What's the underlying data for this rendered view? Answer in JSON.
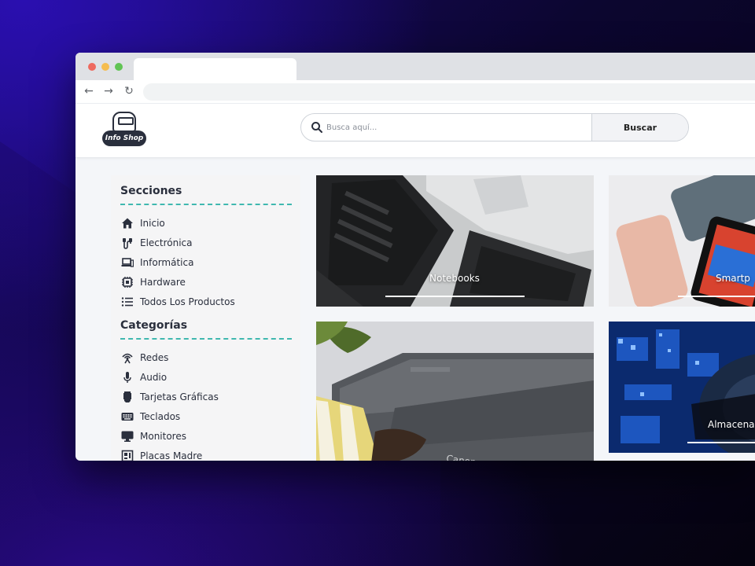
{
  "header": {
    "logo_text": "Info Shop",
    "search": {
      "placeholder": "Busca aquí...",
      "value": "",
      "button_label": "Buscar"
    }
  },
  "sidebar": {
    "sections_title": "Secciones",
    "sections": [
      {
        "label": "Inicio",
        "icon": "home-icon"
      },
      {
        "label": "Electrónica",
        "icon": "electronics-icon"
      },
      {
        "label": "Informática",
        "icon": "laptop-icon"
      },
      {
        "label": "Hardware",
        "icon": "chip-icon"
      },
      {
        "label": "Todos Los Productos",
        "icon": "list-icon"
      }
    ],
    "categories_title": "Categorías",
    "categories": [
      {
        "label": "Redes",
        "icon": "antenna-icon"
      },
      {
        "label": "Audio",
        "icon": "microphone-icon"
      },
      {
        "label": "Tarjetas Gráficas",
        "icon": "gpu-icon"
      },
      {
        "label": "Teclados",
        "icon": "keyboard-icon"
      },
      {
        "label": "Monitores",
        "icon": "monitor-icon"
      },
      {
        "label": "Placas Madre",
        "icon": "motherboard-icon"
      }
    ]
  },
  "cards": [
    {
      "title": "Notebooks"
    },
    {
      "title": "Smartp"
    },
    {
      "title": ""
    },
    {
      "title": "Almacena"
    }
  ],
  "colors": {
    "accent_dash": "#3fb8af",
    "text_dark": "#2a2f3d"
  }
}
